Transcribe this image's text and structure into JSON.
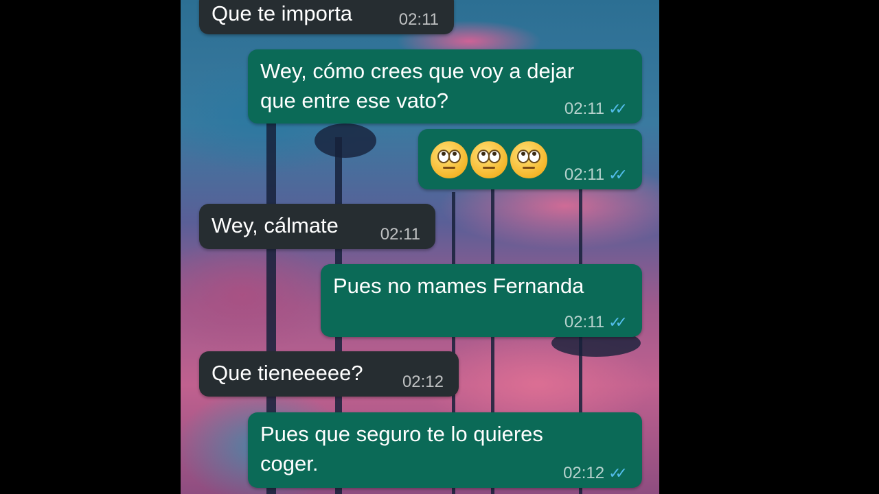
{
  "messages": [
    {
      "id": "m1",
      "direction": "incoming",
      "text": "Que te importa",
      "time": "02:11"
    },
    {
      "id": "m2",
      "direction": "outgoing",
      "text": "Wey, cómo crees que voy a dejar\nque entre ese vato?",
      "time": "02:11",
      "status": "read"
    },
    {
      "id": "m3",
      "direction": "outgoing",
      "emoji": [
        "face-with-rolling-eyes",
        "face-with-rolling-eyes",
        "face-with-rolling-eyes"
      ],
      "time": "02:11",
      "status": "read"
    },
    {
      "id": "m4",
      "direction": "incoming",
      "text": "Wey, cálmate",
      "time": "02:11"
    },
    {
      "id": "m5",
      "direction": "outgoing",
      "text": "Pues no mames Fernanda",
      "time": "02:11",
      "status": "read"
    },
    {
      "id": "m6",
      "direction": "incoming",
      "text": "Que tieneeeee?",
      "time": "02:12"
    },
    {
      "id": "m7",
      "direction": "outgoing",
      "text": "Pues que seguro te lo quieres\ncoger.",
      "time": "02:12",
      "status": "read"
    }
  ],
  "read_receipt_glyph": "✓✓",
  "colors": {
    "incoming_bubble": "#262d31",
    "outgoing_bubble": "#0b6a57",
    "read_ticks": "#53bdeb",
    "side_bars": "#000000"
  }
}
